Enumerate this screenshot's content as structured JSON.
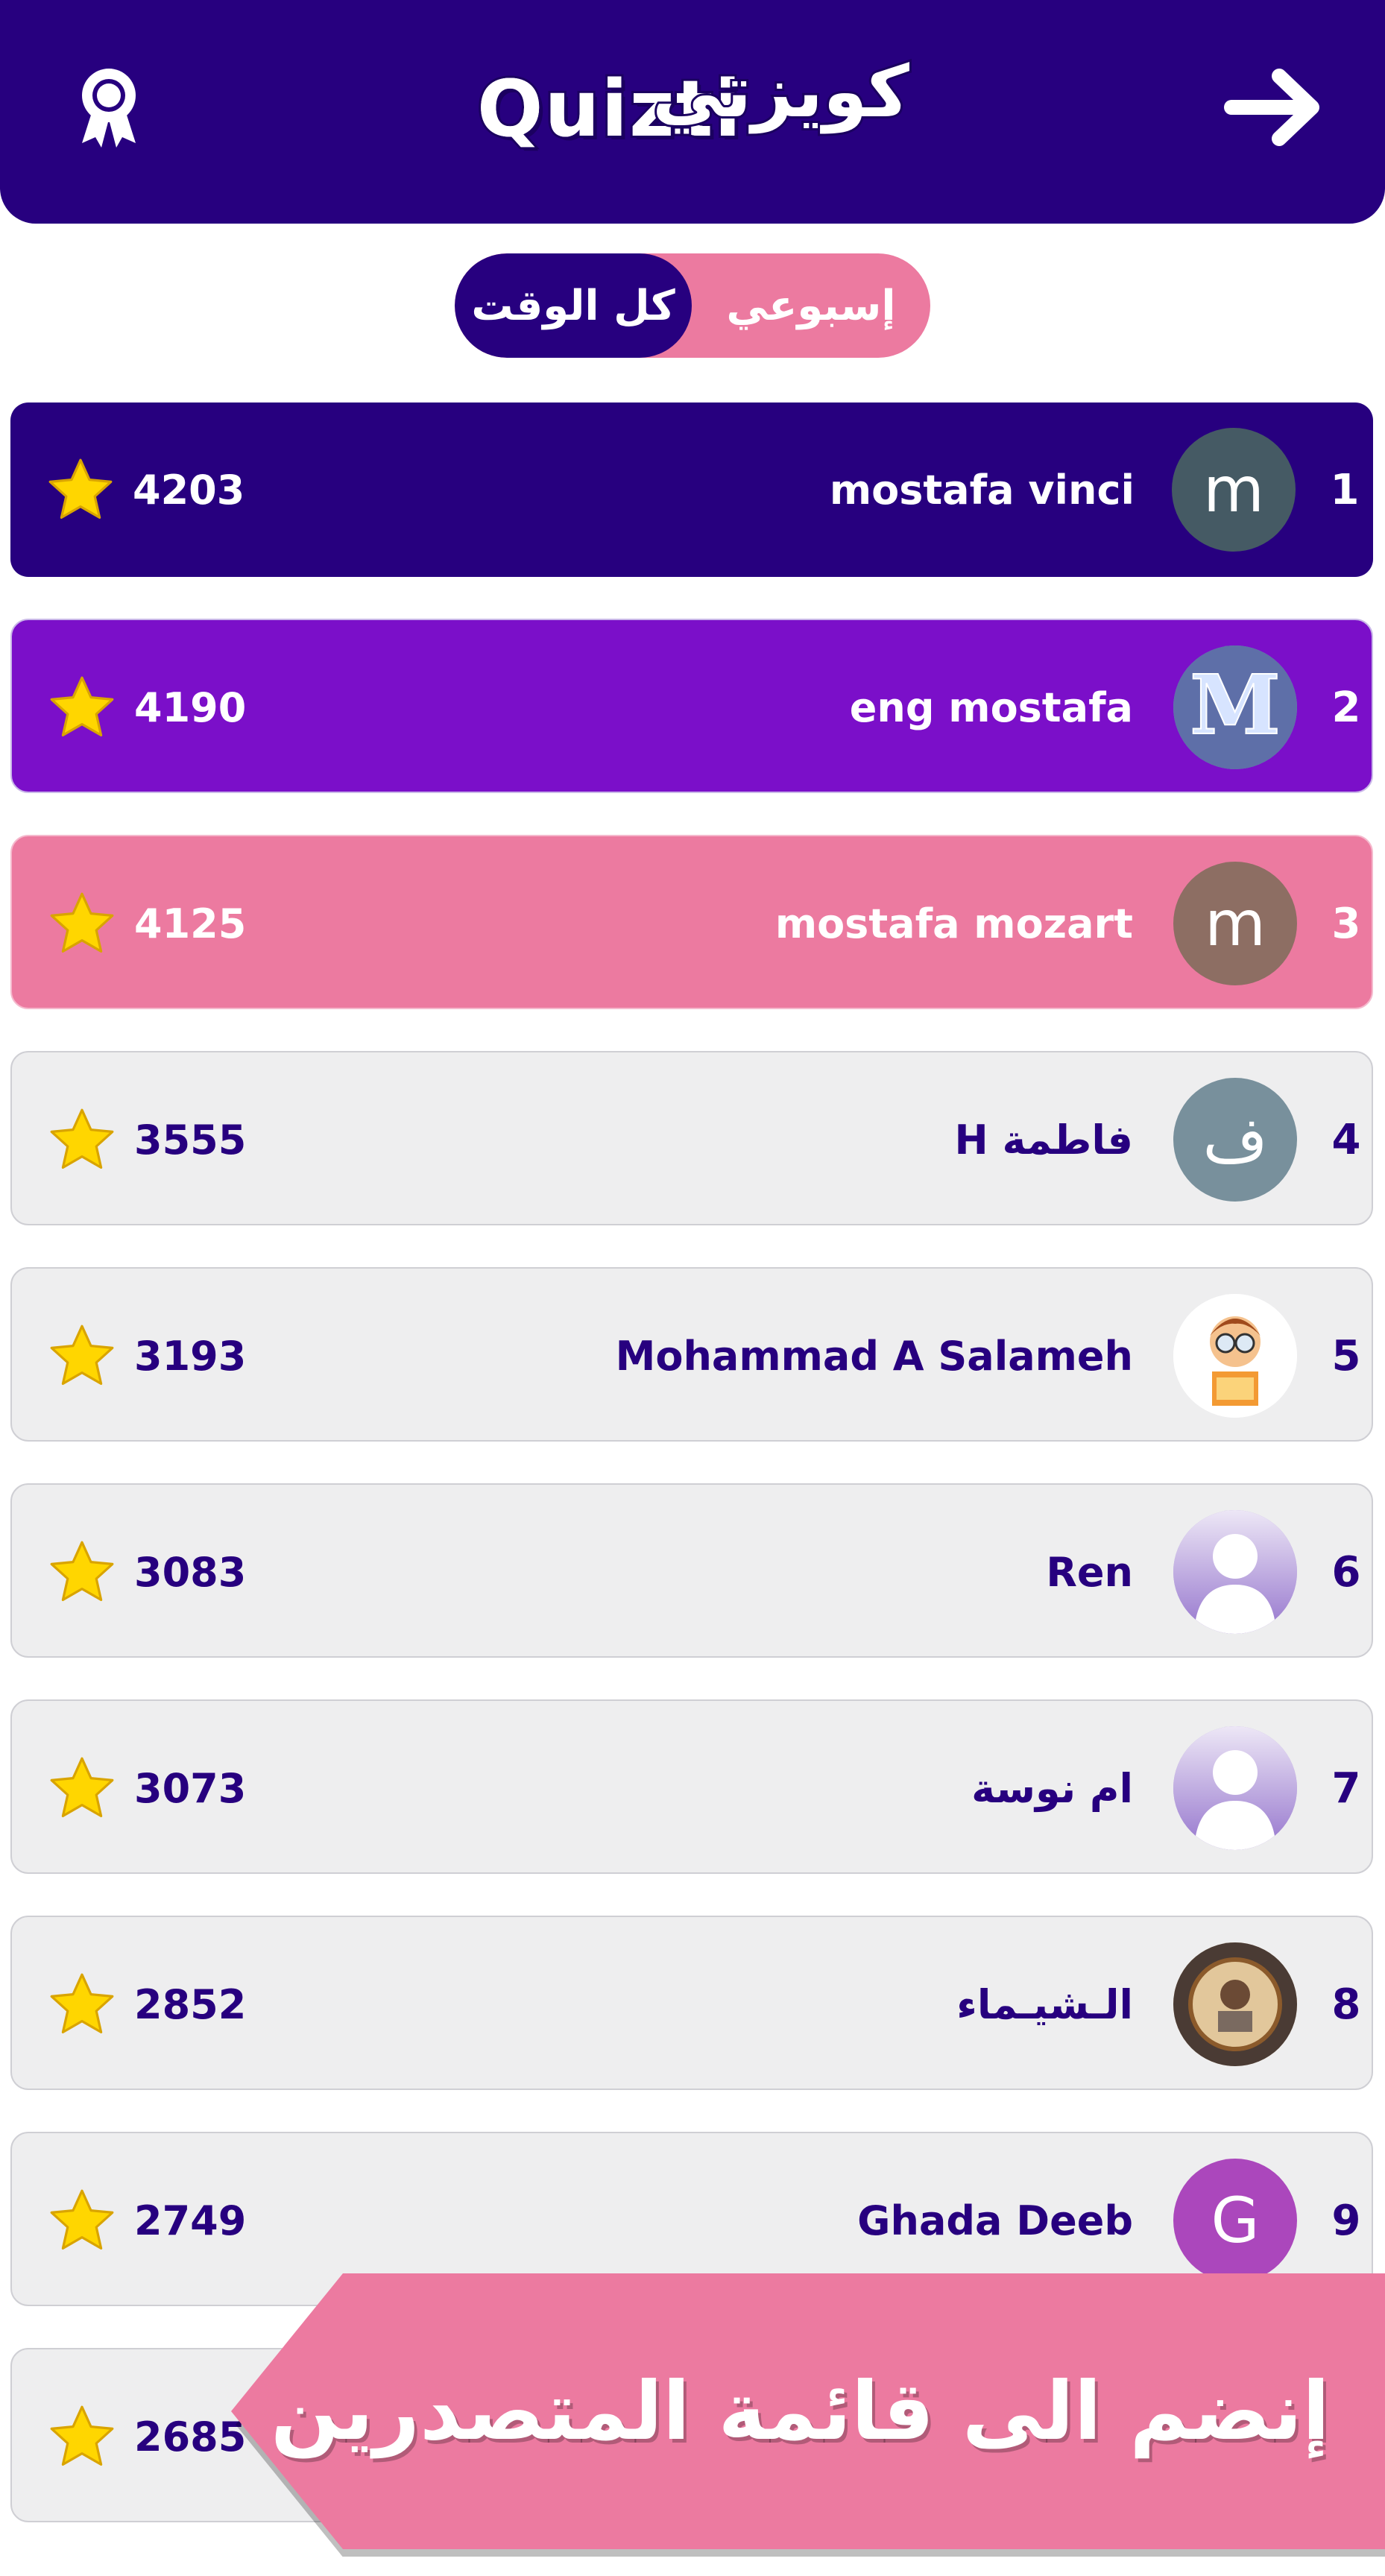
{
  "header": {
    "logo_text_latin": "Quizti",
    "logo_text_arabic": "كويزتي",
    "badge_icon": "ribbon-award-icon",
    "back_icon": "arrow-right-icon",
    "colors": {
      "header_bg": "#27007f"
    }
  },
  "tabs": {
    "all_time_label": "كل الوقت",
    "weekly_label": "إسبوعي",
    "active": "all_time"
  },
  "leaderboard": [
    {
      "rank": "1",
      "name": "mostafa vinci",
      "score": "4203",
      "avatar_letter": "m",
      "avatar_color": "#455a64"
    },
    {
      "rank": "2",
      "name": "eng mostafa",
      "score": "4190",
      "avatar_letter": "",
      "avatar_color": "#7f95c2"
    },
    {
      "rank": "3",
      "name": "mostafa mozart",
      "score": "4125",
      "avatar_letter": "m",
      "avatar_color": "#8d6e63"
    },
    {
      "rank": "4",
      "name": "فاطمة H",
      "score": "3555",
      "avatar_letter": "ف",
      "avatar_color": "#78909c"
    },
    {
      "rank": "5",
      "name": "Mohammad A Salameh",
      "score": "3193",
      "avatar_letter": "",
      "avatar_color": "#ffffff"
    },
    {
      "rank": "6",
      "name": "Ren",
      "score": "3083",
      "avatar_letter": "",
      "avatar_color": "#b39ddb"
    },
    {
      "rank": "7",
      "name": "ام نوسة",
      "score": "3073",
      "avatar_letter": "",
      "avatar_color": "#b39ddb"
    },
    {
      "rank": "8",
      "name": "الـشيـماء",
      "score": "2852",
      "avatar_letter": "",
      "avatar_color": "#d7b58a"
    },
    {
      "rank": "9",
      "name": "Ghada Deeb",
      "score": "2749",
      "avatar_letter": "G",
      "avatar_color": "#ab47bc"
    },
    {
      "rank": "",
      "name": "",
      "score": "2685",
      "avatar_letter": "",
      "avatar_color": ""
    }
  ],
  "banner": {
    "text": "إنضم الى قائمة المتصدرين",
    "color": "#ec7aa0"
  },
  "star_color": "#ffd600"
}
